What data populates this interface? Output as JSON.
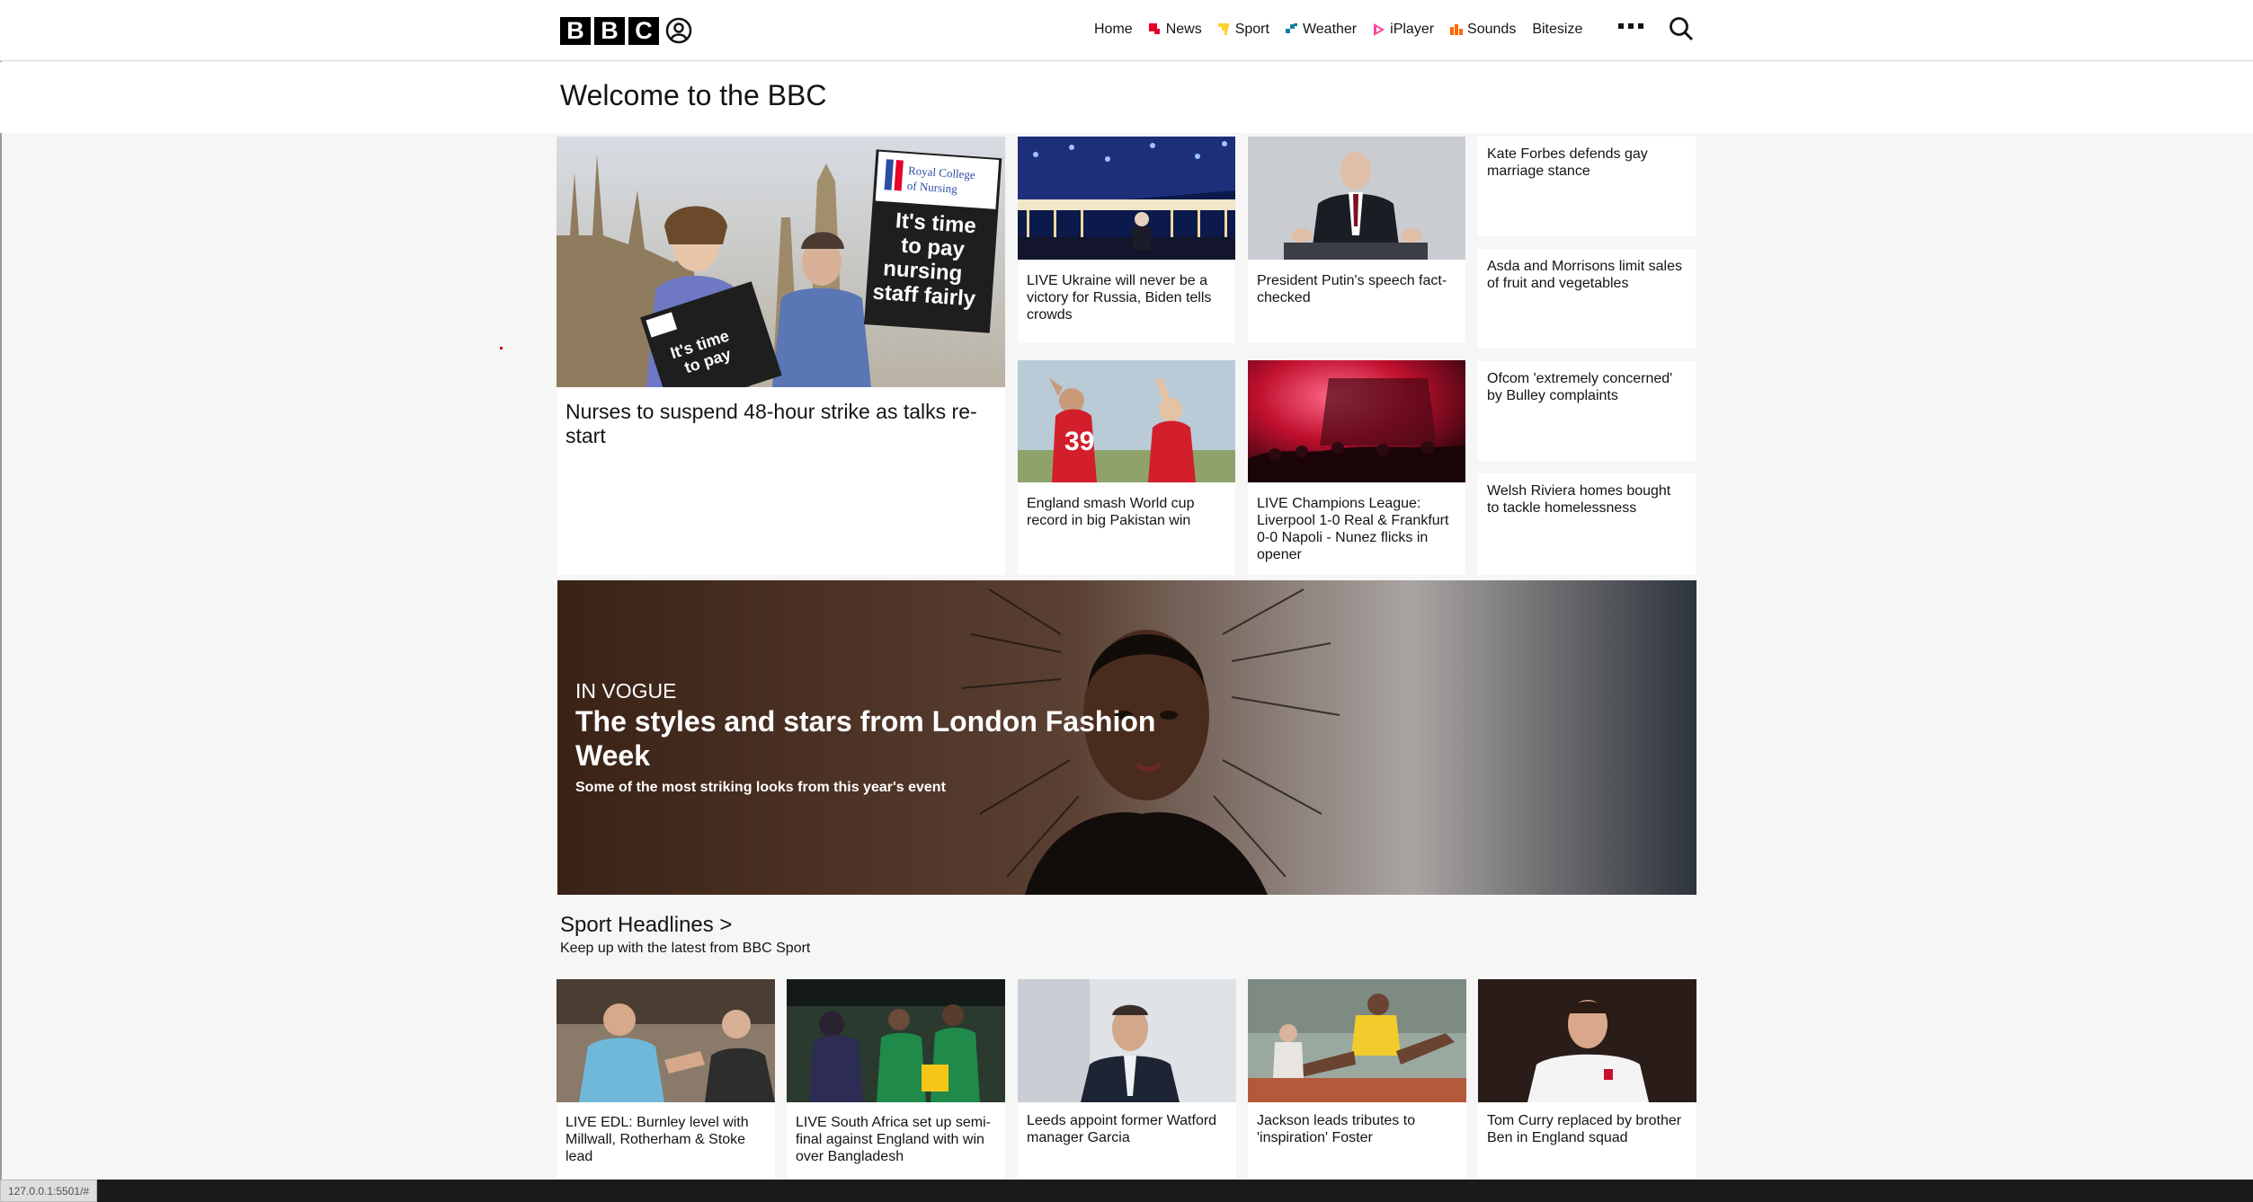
{
  "header": {
    "logo_letters": [
      "B",
      "B",
      "C"
    ],
    "nav": [
      {
        "label": "Home",
        "icon": "home",
        "color": ""
      },
      {
        "label": "News",
        "icon": "news-icon",
        "color": "#e4002b"
      },
      {
        "label": "Sport",
        "icon": "sport-icon",
        "color": "#ffd230"
      },
      {
        "label": "Weather",
        "icon": "weather-icon",
        "color": "#1380a1"
      },
      {
        "label": "iPlayer",
        "icon": "iplayer-icon",
        "color": "#f54997"
      },
      {
        "label": "Sounds",
        "icon": "sounds-icon",
        "color": "#ff6600"
      },
      {
        "label": "Bitesize",
        "icon": "",
        "color": ""
      }
    ]
  },
  "welcome": "Welcome to the BBC",
  "top_stories": {
    "lead": "Nurses to suspend 48-hour strike as talks re-start",
    "lead_sign_text": "It's time to pay nursing staff fairly",
    "lead_sign_org": "Royal College of Nursing",
    "cards": [
      "LIVE Ukraine will never be a victory for Russia, Biden tells crowds",
      "President Putin's speech fact-checked",
      "England smash World cup record in big Pakistan win",
      "LIVE Champions League: Liverpool 1-0 Real & Frankfurt 0-0 Napoli - Nunez flicks in opener"
    ],
    "text_links": [
      "Kate Forbes defends gay marriage stance",
      "Asda and Morrisons limit sales of fruit and vegetables",
      "Ofcom 'extremely concerned' by Bulley complaints",
      "Welsh Riviera homes bought to tackle homelessness"
    ]
  },
  "promo": {
    "kicker": "IN VOGUE",
    "headline": "The styles and stars from London Fashion Week",
    "summary": "Some of the most striking looks from this year's event"
  },
  "sport": {
    "title": "Sport Headlines >",
    "subtitle": "Keep up with the latest from BBC Sport",
    "cards": [
      "LIVE EDL: Burnley level with Millwall, Rotherham & Stoke lead",
      "LIVE South Africa set up semi-final against England with win over Bangladesh",
      "Leeds appoint former Watford manager Garcia",
      "Jackson leads tributes to 'inspiration' Foster",
      "Tom Curry replaced by brother Ben in England squad"
    ]
  },
  "status_url": "127.0.0.1:5501/#"
}
